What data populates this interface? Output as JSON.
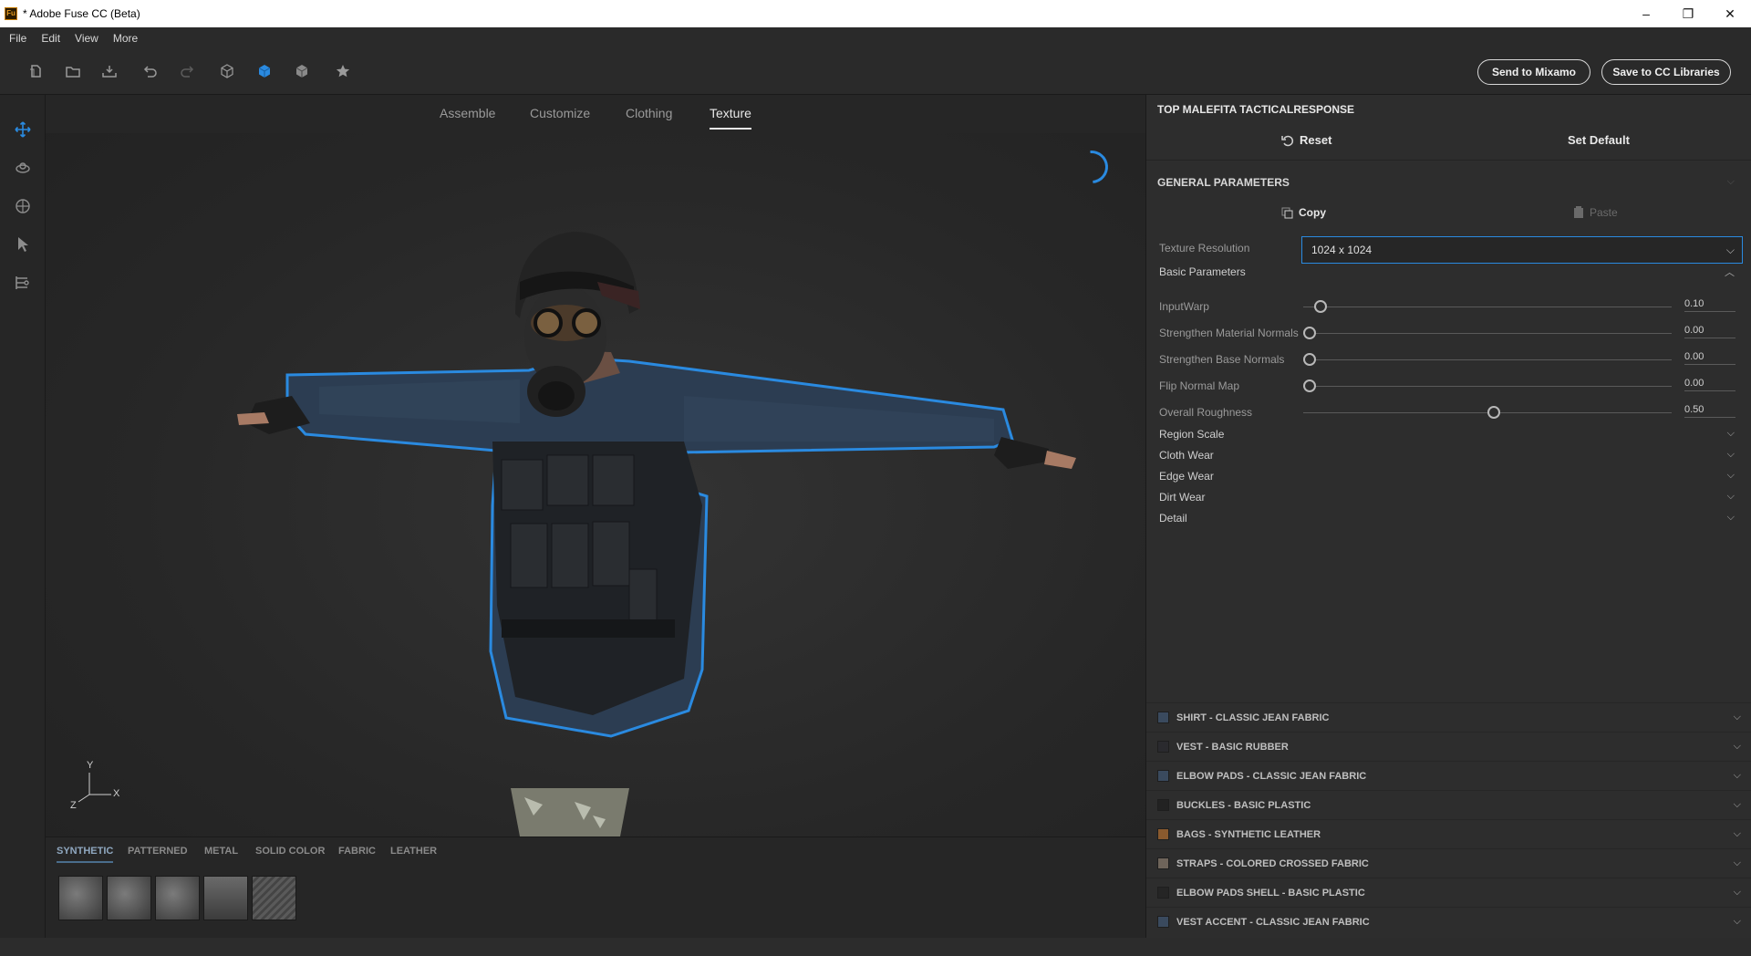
{
  "window": {
    "title": "* Adobe Fuse CC (Beta)",
    "app_icon": "Fu",
    "minimize": "–",
    "restore": "❐",
    "close": "✕"
  },
  "menu": [
    "File",
    "Edit",
    "View",
    "More"
  ],
  "toolbar": {
    "icons": [
      "new-icon",
      "open-icon",
      "import-icon",
      "undo-icon",
      "redo-icon",
      "wireframe-cube-icon",
      "solid-cube-icon",
      "textured-cube-icon",
      "favorite-star-icon"
    ],
    "send_label": "Send to Mixamo",
    "save_label": "Save to CC Libraries",
    "accent": "#2a8ae0"
  },
  "left_tools": [
    "move-icon",
    "orbit-icon",
    "target-icon",
    "select-arrow-icon",
    "render-settings-icon"
  ],
  "viewport": {
    "tabs": [
      "Assemble",
      "Customize",
      "Clothing",
      "Texture"
    ],
    "active_tab": "Texture",
    "axis": {
      "y": "Y",
      "z": "Z",
      "x": "X"
    }
  },
  "materials": {
    "tabs": [
      "SYNTHETIC",
      "PATTERNED",
      "METAL",
      "SOLID COLOR",
      "FABRIC",
      "LEATHER"
    ],
    "active_tab": "SYNTHETIC",
    "swatch_count": 5
  },
  "panel": {
    "title": "TOP MALEFITA TACTICALRESPONSE",
    "reset_label": "Reset",
    "set_default_label": "Set Default",
    "general_parameters": "GENERAL PARAMETERS",
    "copy_label": "Copy",
    "paste_label": "Paste",
    "texture_resolution_label": "Texture Resolution",
    "texture_resolution_value": "1024 x 1024",
    "basic_parameters": "Basic Parameters",
    "sliders": [
      {
        "label": "InputWarp",
        "value": "0.10",
        "level": 0.03
      },
      {
        "label": "Strengthen Material Normals",
        "value": "0.00",
        "level": 0.0
      },
      {
        "label": "Strengthen Base Normals",
        "value": "0.00",
        "level": 0.0
      },
      {
        "label": "Flip Normal Map",
        "value": "0.00",
        "level": 0.0
      },
      {
        "label": "Overall Roughness",
        "value": "0.50",
        "level": 0.5
      }
    ],
    "groups": [
      "Region Scale",
      "Cloth Wear",
      "Edge Wear",
      "Dirt Wear",
      "Detail"
    ],
    "material_list": [
      {
        "name": "SHIRT - CLASSIC JEAN FABRIC",
        "color": "#3a4a5e"
      },
      {
        "name": "VEST - BASIC RUBBER",
        "color": "#2a2a2e"
      },
      {
        "name": "ELBOW PADS - CLASSIC JEAN FABRIC",
        "color": "#3a4a5e"
      },
      {
        "name": "BUCKLES - BASIC PLASTIC",
        "color": "#222"
      },
      {
        "name": "BAGS - SYNTHETIC LEATHER",
        "color": "#8a5a2e"
      },
      {
        "name": "STRAPS - COLORED CROSSED FABRIC",
        "color": "#6e645a"
      },
      {
        "name": "ELBOW PADS SHELL - BASIC PLASTIC",
        "color": "#252525"
      },
      {
        "name": "VEST ACCENT - CLASSIC JEAN FABRIC",
        "color": "#3a4a5e"
      }
    ]
  }
}
